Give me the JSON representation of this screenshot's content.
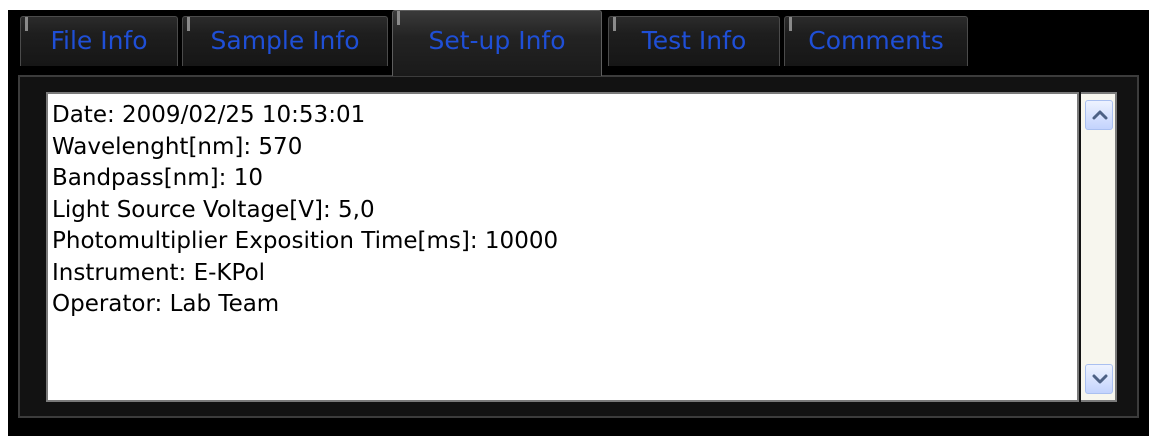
{
  "tabs": [
    {
      "label": "File Info",
      "active": false
    },
    {
      "label": "Sample Info",
      "active": false
    },
    {
      "label": "Set-up Info",
      "active": true
    },
    {
      "label": "Test Info",
      "active": false
    },
    {
      "label": "Comments",
      "active": false
    }
  ],
  "content": {
    "lines": [
      "Date: 2009/02/25 10:53:01",
      "Wavelenght[nm]: 570",
      "Bandpass[nm]: 10",
      "Light Source Voltage[V]: 5,0",
      "Photomultiplier Exposition Time[ms]: 10000",
      "Instrument: E-KPol",
      "Operator: Lab Team"
    ]
  },
  "scrollbar": {
    "up_icon": "chevron-up-icon",
    "down_icon": "chevron-down-icon"
  },
  "colors": {
    "tab_text": "#1f4fd6",
    "panel_bg": "#000000",
    "scroll_button": "#c3d3fd"
  }
}
